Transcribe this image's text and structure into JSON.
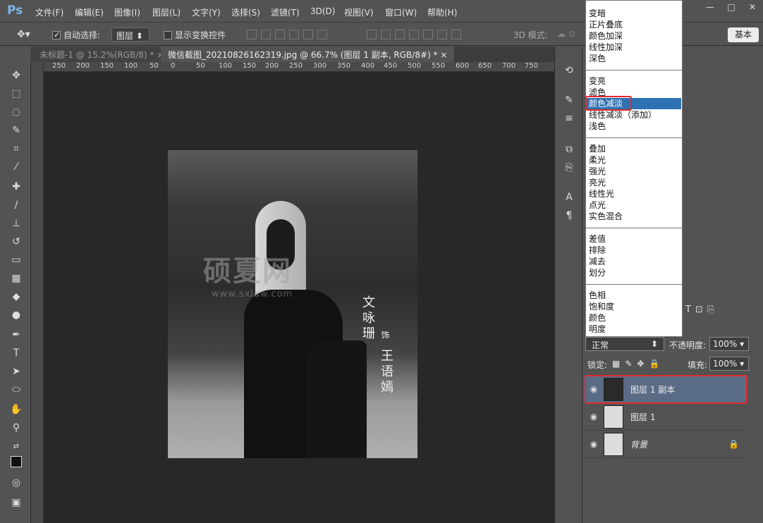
{
  "menubar": {
    "logo": "Ps",
    "items": [
      "文件(F)",
      "编辑(E)",
      "图像(I)",
      "图层(L)",
      "文字(Y)",
      "选择(S)",
      "滤镜(T)",
      "3D(D)",
      "视图(V)",
      "窗口(W)",
      "帮助(H)"
    ]
  },
  "window_controls": {
    "minimize": "—",
    "maximize": "□",
    "close": "✕"
  },
  "options": {
    "auto_select_label": "自动选择:",
    "auto_select_target": "图层",
    "show_transform_label": "显示变换控件",
    "mode_3d_label": "3D 模式:",
    "workspace_button": "基本"
  },
  "tabs": [
    {
      "label": "未标题-1 @ 15.2%(RGB/8) *",
      "close": "×"
    },
    {
      "label": "微信截图_20210826162319.jpg @ 66.7% (图层 1 副本, RGB/8#) *",
      "close": "×"
    }
  ],
  "ruler_ticks": [
    "250",
    "200",
    "150",
    "100",
    "50",
    "0",
    "50",
    "100",
    "150",
    "200",
    "250",
    "300",
    "350",
    "400",
    "450",
    "500",
    "550",
    "600",
    "650",
    "700",
    "750"
  ],
  "document": {
    "poem_line1": "文咏珊",
    "poem_small": "饰",
    "poem_line2": "王语嫣",
    "watermark": "硕夏网",
    "watermark_url": "www.sxiaw.com"
  },
  "blend_modes": {
    "group1": [
      "变暗",
      "正片叠底",
      "颜色加深",
      "线性加深",
      "深色"
    ],
    "group2": [
      "变亮",
      "滤色",
      "颜色减淡",
      "线性减淡（添加）",
      "浅色"
    ],
    "group3": [
      "叠加",
      "柔光",
      "强光",
      "亮光",
      "线性光",
      "点光",
      "实色混合"
    ],
    "group4": [
      "差值",
      "排除",
      "减去",
      "划分"
    ],
    "group5": [
      "色相",
      "饱和度",
      "颜色",
      "明度"
    ],
    "highlighted": "颜色减淡"
  },
  "layers_panel": {
    "blend_mode_value": "正常",
    "opacity_label": "不透明度:",
    "opacity_value": "100%",
    "lock_label": "锁定:",
    "fill_label": "填充:",
    "fill_value": "100%",
    "layers": [
      {
        "name": "图层 1 副本",
        "selected": true
      },
      {
        "name": "图层 1",
        "selected": false
      },
      {
        "name": "背景",
        "selected": false,
        "locked": true
      }
    ]
  },
  "colors": {
    "highlight_blue": "#2e71b3",
    "annotation_red": "#e02a2a",
    "ps_blue": "#7fb6e8"
  }
}
